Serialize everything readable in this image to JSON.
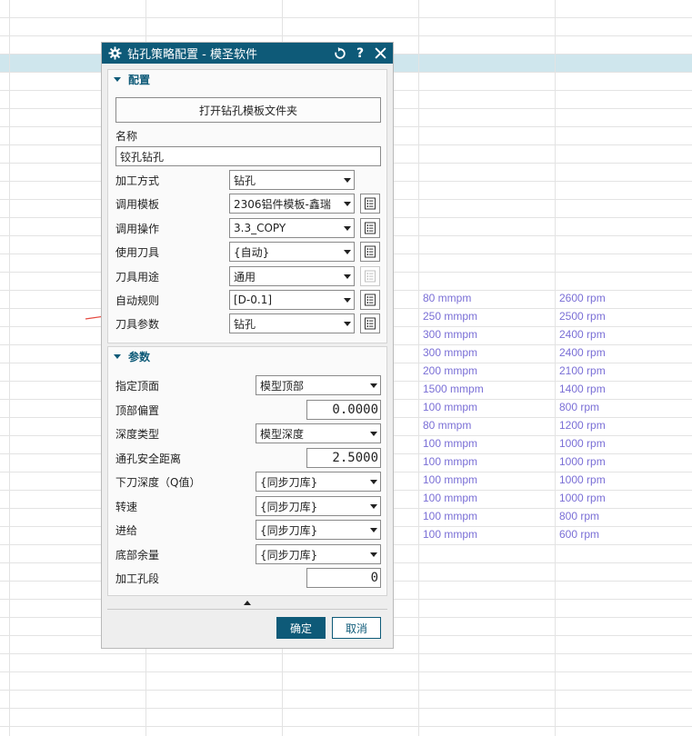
{
  "sheet": {
    "col_b": [
      "80 mmpm",
      "250 mmpm",
      "300 mmpm",
      "300 mmpm",
      "200 mmpm",
      "1500 mmpm",
      "100 mmpm",
      "80 mmpm",
      "100 mmpm",
      "100 mmpm",
      "100 mmpm",
      "100 mmpm",
      "100 mmpm",
      "100 mmpm"
    ],
    "col_c": [
      "2600 rpm",
      "2500 rpm",
      "2400 rpm",
      "2400 rpm",
      "2100 rpm",
      "1400 rpm",
      "800 rpm",
      "1200 rpm",
      "1000 rpm",
      "1000 rpm",
      "1000 rpm",
      "1000 rpm",
      "800 rpm",
      "600 rpm"
    ]
  },
  "dialog": {
    "title": "钻孔策略配置 - 模圣软件",
    "title_icon": "gear-icon",
    "reset_icon": "reset-icon",
    "help": "?",
    "close_icon": "close-icon"
  },
  "config": {
    "header": "配置",
    "open_folder_button": "打开钻孔模板文件夹",
    "name_label": "名称",
    "name_value": "铰孔钻孔",
    "rows": [
      {
        "label": "加工方式",
        "value": "钻孔",
        "has_list": false
      },
      {
        "label": "调用模板",
        "value": "2306铝件模板-鑫瑞",
        "has_list": true
      },
      {
        "label": "调用操作",
        "value": "3.3_COPY",
        "has_list": true
      },
      {
        "label": "使用刀具",
        "value": "{自动}",
        "has_list": true
      },
      {
        "label": "刀具用途",
        "value": "通用",
        "has_list": true,
        "list_disabled": true
      },
      {
        "label": "自动规则",
        "value": "[D-0.1]",
        "has_list": true
      },
      {
        "label": "刀具参数",
        "value": "钻孔",
        "has_list": true
      }
    ]
  },
  "params": {
    "header": "参数",
    "rows": [
      {
        "label": "指定顶面",
        "type": "select",
        "value": "模型顶部"
      },
      {
        "label": "顶部偏置",
        "type": "number",
        "value": "0.0000"
      },
      {
        "label": "深度类型",
        "type": "select",
        "value": "模型深度"
      },
      {
        "label": "通孔安全距离",
        "type": "number",
        "value": "2.5000"
      },
      {
        "label": "下刀深度（Q值）",
        "type": "select",
        "value": "{同步刀库}"
      },
      {
        "label": "转速",
        "type": "select",
        "value": "{同步刀库}"
      },
      {
        "label": "进给",
        "type": "select",
        "value": "{同步刀库}"
      },
      {
        "label": "底部余量",
        "type": "select",
        "value": "{同步刀库}"
      },
      {
        "label": "加工孔段",
        "type": "number",
        "value": "0"
      }
    ]
  },
  "footer": {
    "ok": "确定",
    "cancel": "取消"
  },
  "colors": {
    "titlebar": "#0e5a78",
    "sheet_text": "#7a6fd6",
    "arrow": "#e5483f",
    "highlight_row": "#cfe6ed"
  }
}
